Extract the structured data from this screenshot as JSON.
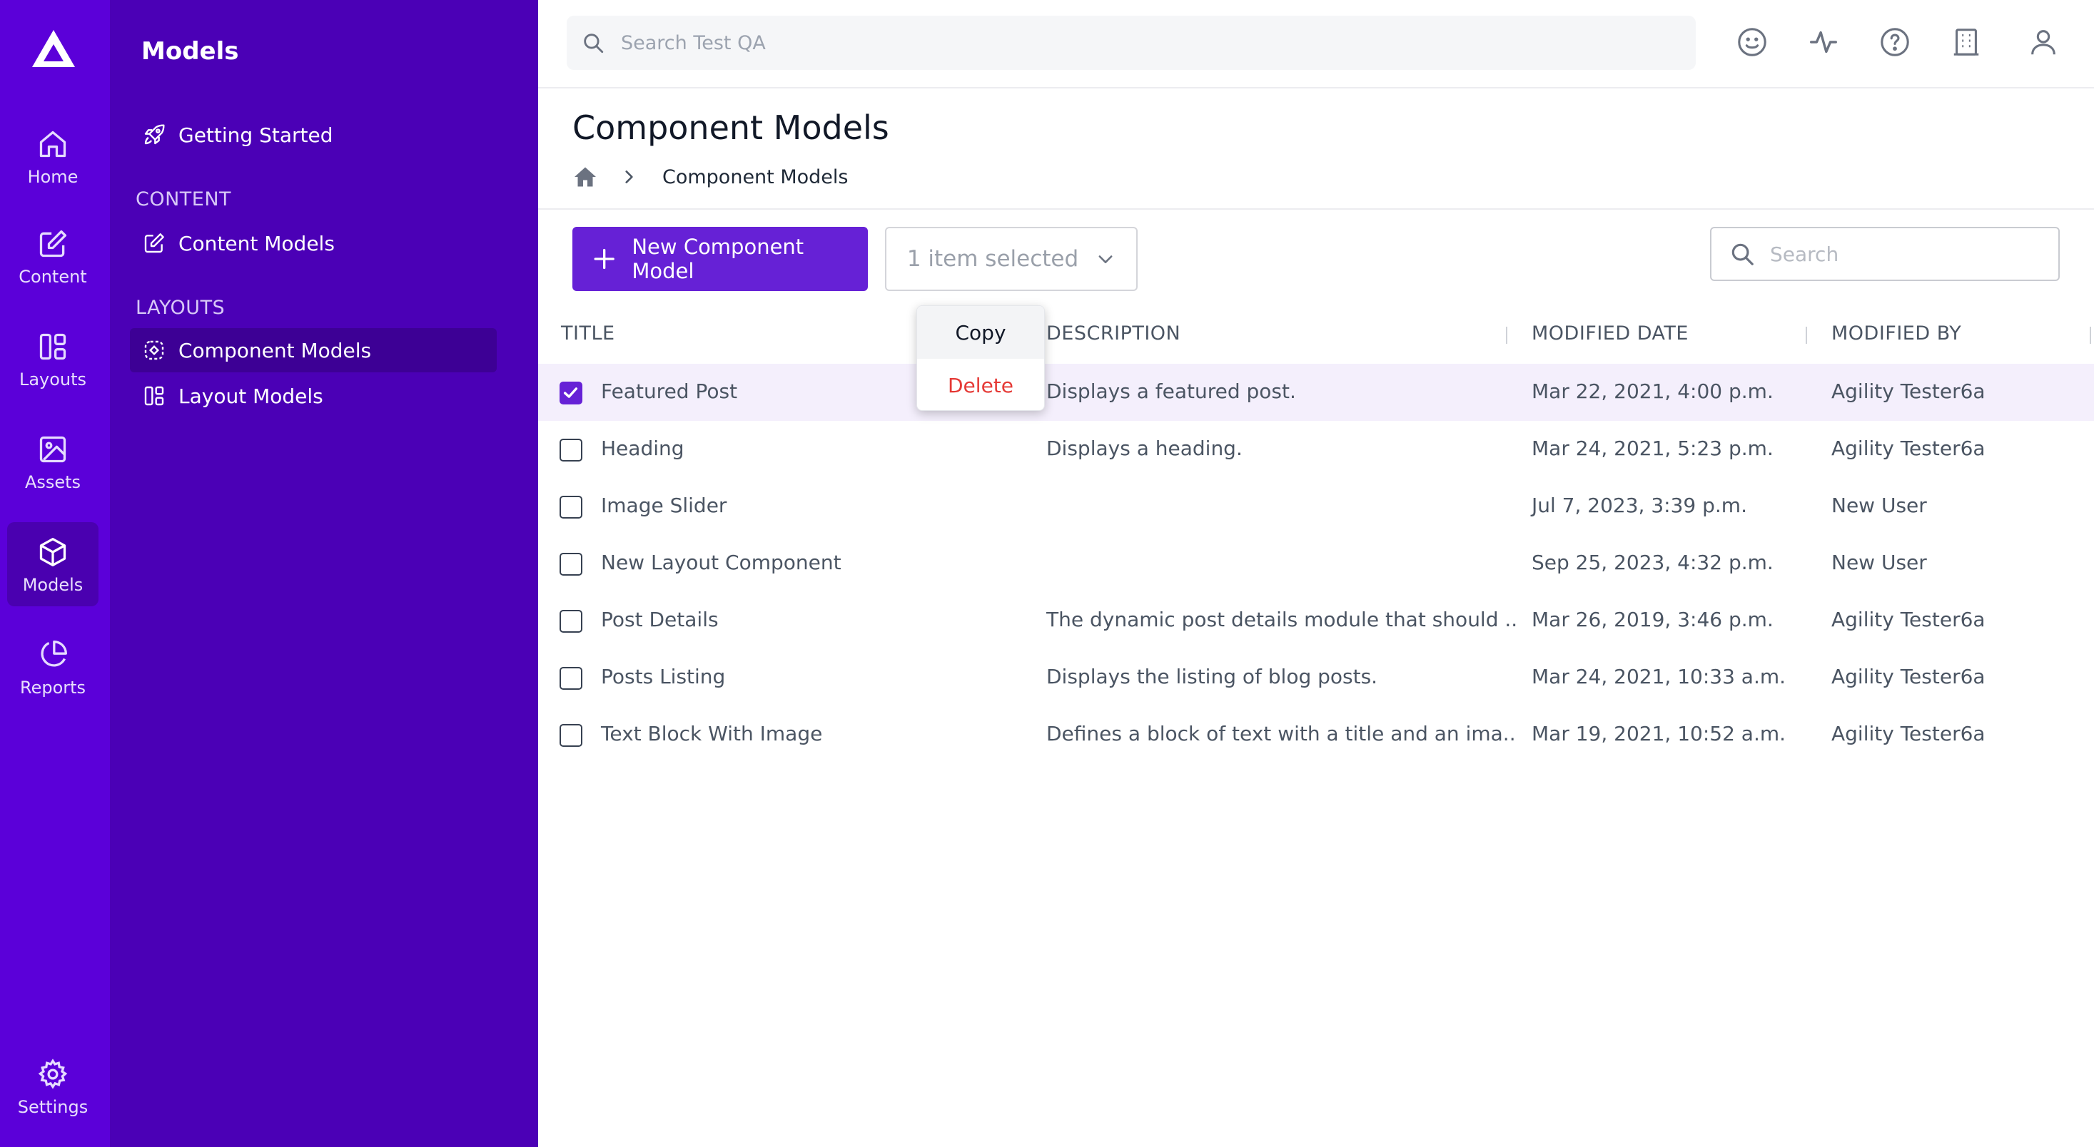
{
  "rail": {
    "items": [
      {
        "label": "Home",
        "icon": "home-icon"
      },
      {
        "label": "Content",
        "icon": "edit-icon"
      },
      {
        "label": "Layouts",
        "icon": "layout-icon"
      },
      {
        "label": "Assets",
        "icon": "image-icon"
      },
      {
        "label": "Models",
        "icon": "cube-icon",
        "active": true
      },
      {
        "label": "Reports",
        "icon": "pie-chart-icon"
      }
    ],
    "settings_label": "Settings"
  },
  "sidebar": {
    "title": "Models",
    "getting_started": "Getting Started",
    "section_content": "CONTENT",
    "content_models": "Content Models",
    "section_layouts": "LAYOUTS",
    "component_models": "Component Models",
    "layout_models": "Layout Models"
  },
  "topbar": {
    "search_placeholder": "Search Test QA",
    "icons": [
      "smiley-icon",
      "activity-icon",
      "help-icon",
      "building-icon",
      "user-icon"
    ]
  },
  "page": {
    "title": "Component Models",
    "breadcrumb": "Component Models"
  },
  "toolbar": {
    "new_button": "New Component Model",
    "selection_label": "1 item selected",
    "search_placeholder": "Search"
  },
  "menu": {
    "copy": "Copy",
    "delete": "Delete"
  },
  "table": {
    "headers": {
      "title": "TITLE",
      "description": "DESCRIPTION",
      "modified_date": "MODIFIED DATE",
      "modified_by": "MODIFIED BY"
    },
    "rows": [
      {
        "title": "Featured Post",
        "description": "Displays a featured post.",
        "modified_date": "Mar 22, 2021, 4:00 p.m.",
        "modified_by": "Agility Tester6a",
        "checked": true
      },
      {
        "title": "Heading",
        "description": "Displays a heading.",
        "modified_date": "Mar 24, 2021, 5:23 p.m.",
        "modified_by": "Agility Tester6a",
        "checked": false
      },
      {
        "title": "Image Slider",
        "description": "",
        "modified_date": "Jul 7, 2023, 3:39 p.m.",
        "modified_by": "New User",
        "checked": false
      },
      {
        "title": "New Layout Component",
        "description": "",
        "modified_date": "Sep 25, 2023, 4:32 p.m.",
        "modified_by": "New User",
        "checked": false
      },
      {
        "title": "Post Details",
        "description": "The dynamic post details module that should ...",
        "modified_date": "Mar 26, 2019, 3:46 p.m.",
        "modified_by": "Agility Tester6a",
        "checked": false
      },
      {
        "title": "Posts Listing",
        "description": "Displays the listing of blog posts.",
        "modified_date": "Mar 24, 2021, 10:33 a.m.",
        "modified_by": "Agility Tester6a",
        "checked": false
      },
      {
        "title": "Text Block With Image",
        "description": "Defines a block of text with a title and an ima...",
        "modified_date": "Mar 19, 2021, 10:52 a.m.",
        "modified_by": "Agility Tester6a",
        "checked": false
      }
    ]
  },
  "colors": {
    "rail": "#5b00d9",
    "sidebar": "#4b00b6",
    "accent": "#6621d6",
    "danger": "#e53935"
  }
}
